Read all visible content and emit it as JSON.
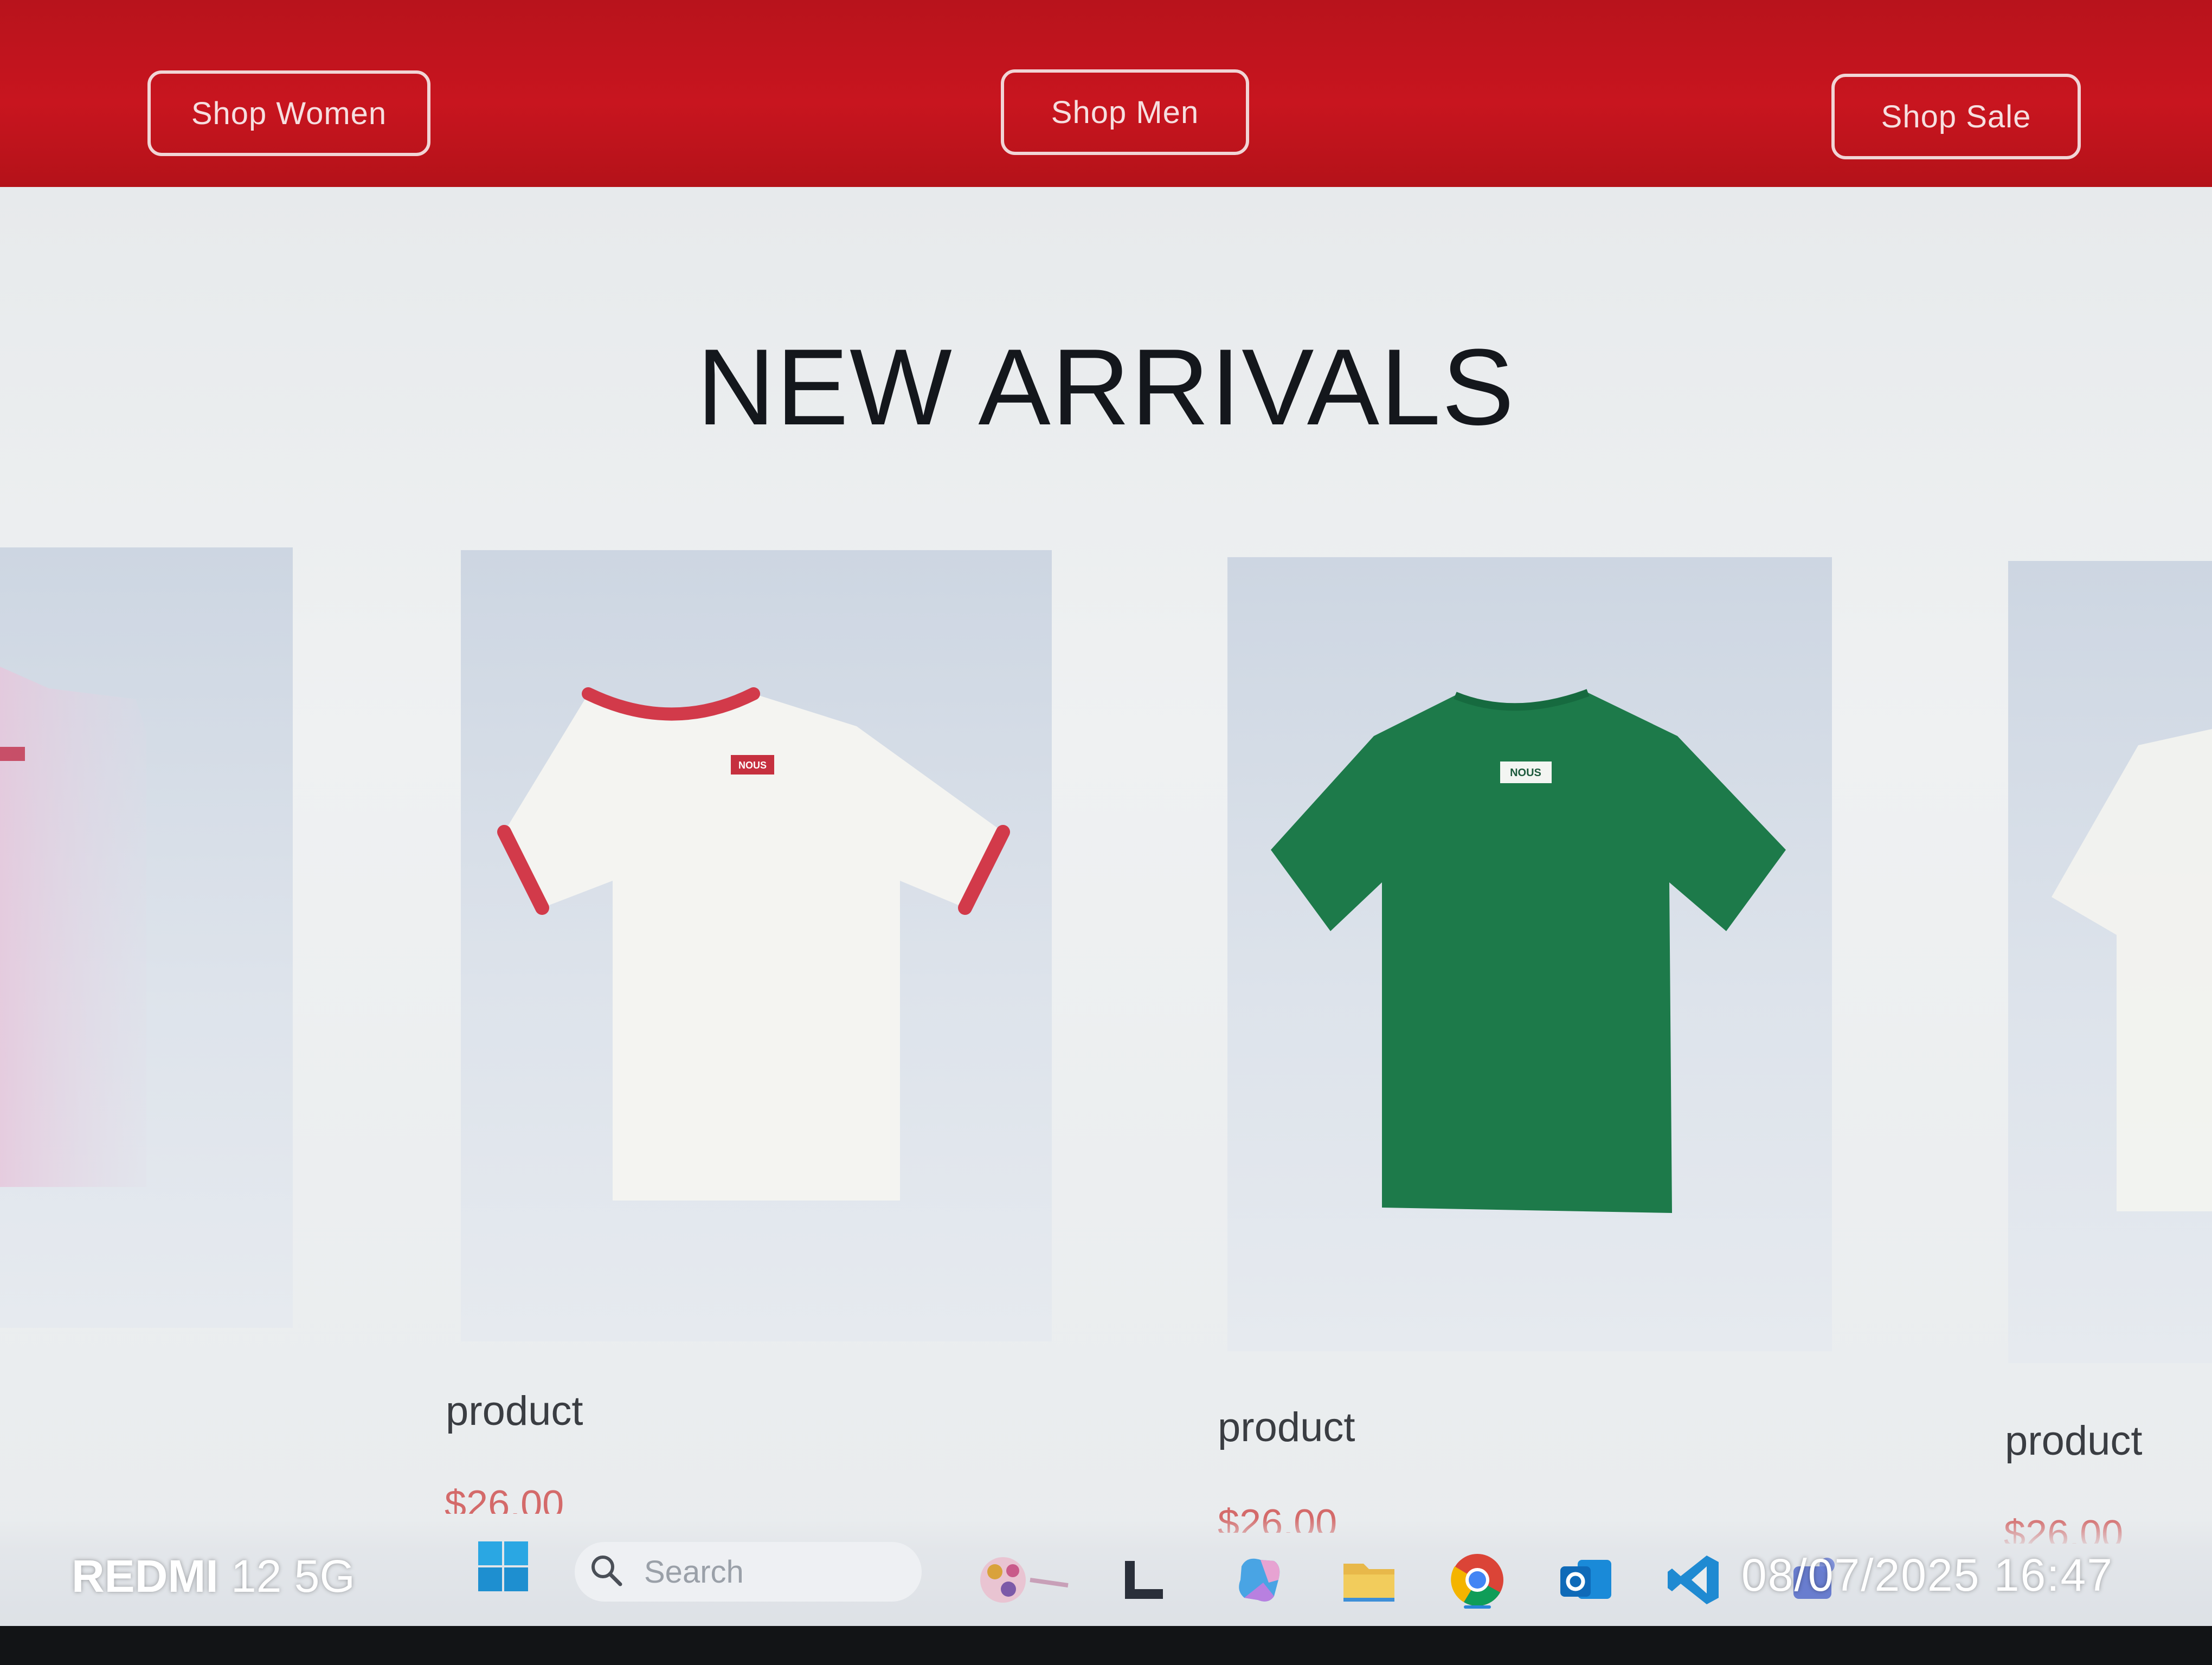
{
  "nav": {
    "shop_women": "Shop Women",
    "shop_men": "Shop Men",
    "shop_sale": "Shop Sale"
  },
  "section": {
    "title": "NEW ARRIVALS"
  },
  "products": [
    {
      "name": "",
      "price": "",
      "image": "pink-tshirt-image"
    },
    {
      "name": "product",
      "price": "$26.00",
      "image": "white-ringer-tshirt-image"
    },
    {
      "name": "product",
      "price": "$26.00",
      "image": "green-tshirt-image"
    },
    {
      "name": "product",
      "price": "$26.00",
      "image": "white-tshirt-image"
    }
  ],
  "tshirt_logo_text": "NOUS",
  "taskbar": {
    "search_placeholder": "Search"
  },
  "camera": {
    "brand": "REDMI",
    "model": "12 5G",
    "datetime": "08/07/2025 16:47"
  },
  "colors": {
    "header_red": "#c8151f",
    "price_red": "#d46a6a",
    "green_tshirt": "#1d7a4a",
    "ringer_trim": "#d23a4a"
  }
}
